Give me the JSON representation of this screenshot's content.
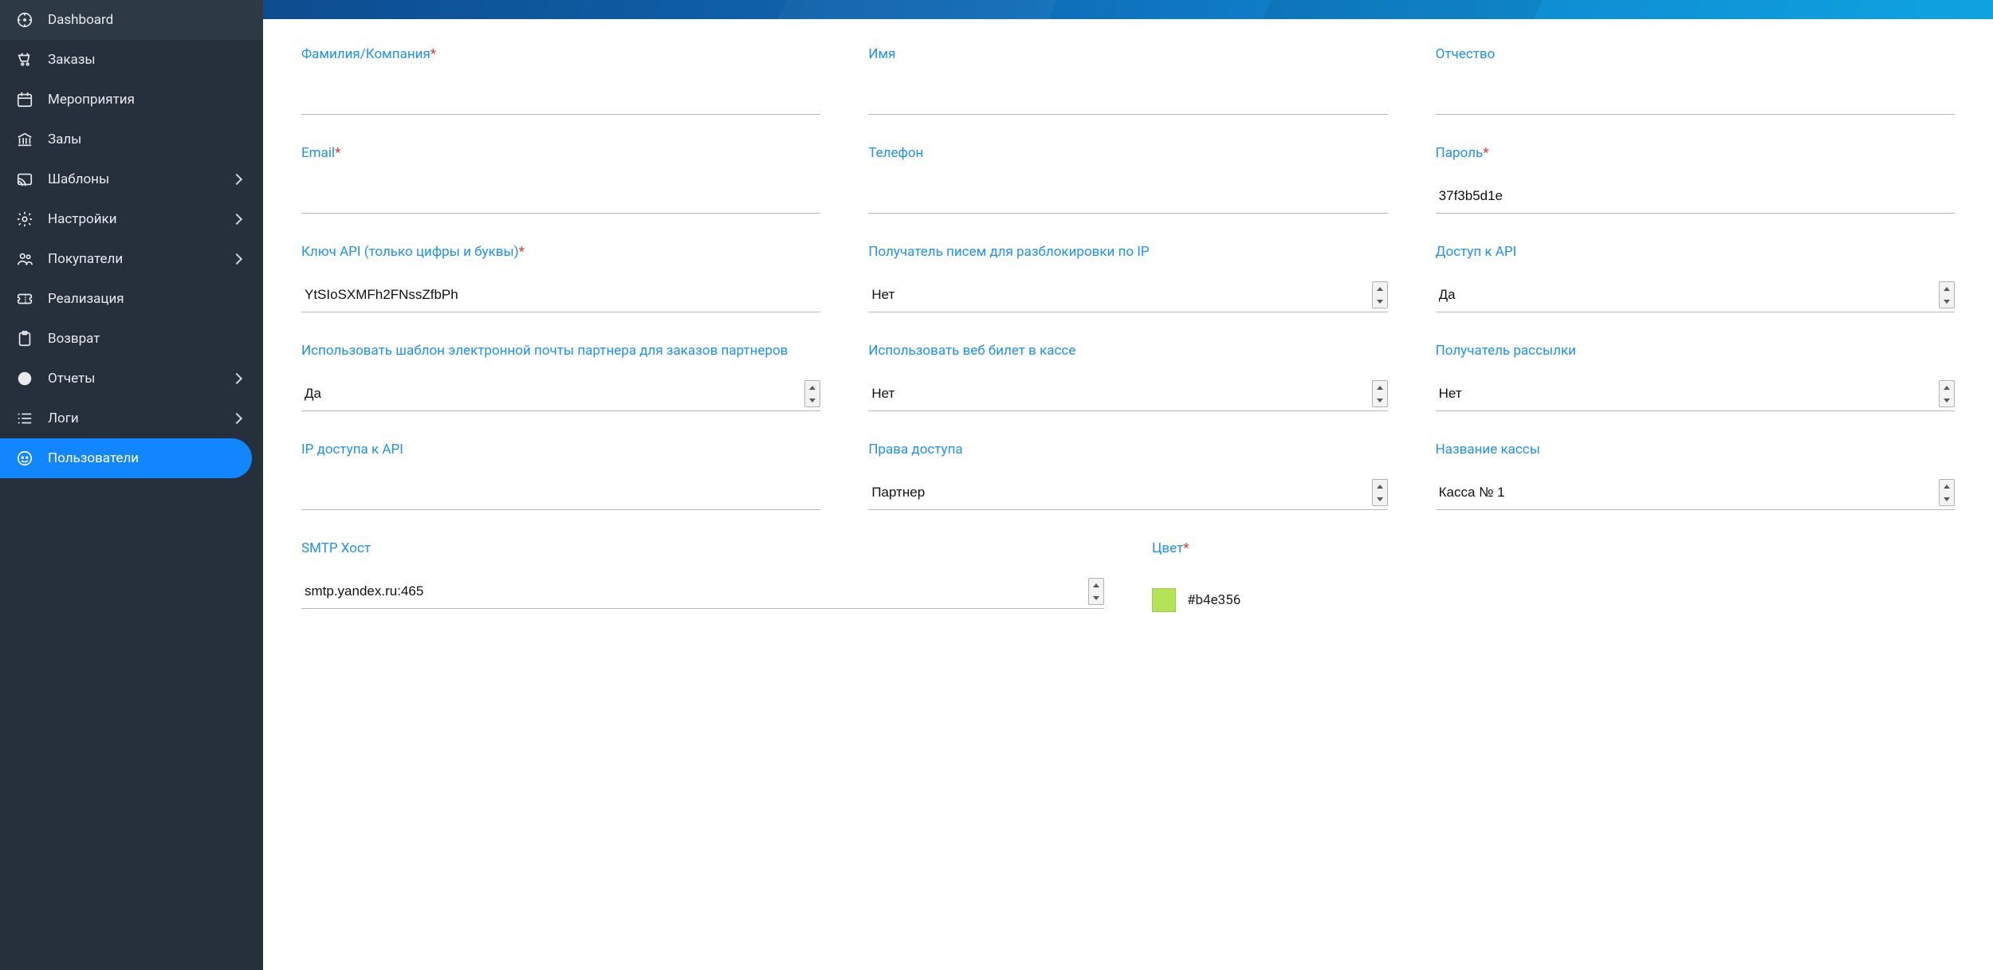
{
  "sidebar": {
    "items": [
      {
        "id": "dashboard",
        "label": "Dashboard",
        "icon": "compass-icon",
        "expandable": false
      },
      {
        "id": "orders",
        "label": "Заказы",
        "icon": "cart-icon",
        "expandable": false
      },
      {
        "id": "events",
        "label": "Мероприятия",
        "icon": "calendar-icon",
        "expandable": false
      },
      {
        "id": "halls",
        "label": "Залы",
        "icon": "bank-icon",
        "expandable": false
      },
      {
        "id": "templates",
        "label": "Шаблоны",
        "icon": "cast-icon",
        "expandable": true
      },
      {
        "id": "settings",
        "label": "Настройки",
        "icon": "gear-icon",
        "expandable": true
      },
      {
        "id": "buyers",
        "label": "Покупатели",
        "icon": "people-icon",
        "expandable": true
      },
      {
        "id": "realize",
        "label": "Реализация",
        "icon": "ticket-icon",
        "expandable": false
      },
      {
        "id": "refund",
        "label": "Возврат",
        "icon": "clipboard-icon",
        "expandable": false
      },
      {
        "id": "reports",
        "label": "Отчеты",
        "icon": "alert-icon",
        "expandable": true
      },
      {
        "id": "logs",
        "label": "Логи",
        "icon": "list-icon",
        "expandable": true
      },
      {
        "id": "users",
        "label": "Пользователи",
        "icon": "face-icon",
        "expandable": false,
        "active": true
      }
    ]
  },
  "form": {
    "labels": {
      "surname": "Фамилия/Компания",
      "name": "Имя",
      "patronym": "Отчество",
      "email": "Email",
      "phone": "Телефон",
      "password": "Пароль",
      "api_key": "Ключ API (только цифры и буквы)",
      "ip_unlock": "Получатель писем для разблокировки по IP",
      "api_access": "Доступ к API",
      "partner_tpl": "Использовать шаблон электронной почты партнера для заказов партнеров",
      "web_ticket": "Использовать веб билет в кассе",
      "mailing": "Получатель рассылки",
      "ip_api": "IP доступа к API",
      "rights": "Права доступа",
      "desk_name": "Название кассы",
      "smtp": "SMTP Хост",
      "color": "Цвет"
    },
    "required": {
      "surname": true,
      "email": true,
      "password": true,
      "api_key": true,
      "color": true
    },
    "values": {
      "surname": "",
      "name": "",
      "patronym": "",
      "email": "",
      "phone": "",
      "password": "37f3b5d1e",
      "api_key": "YtSIoSXMFh2FNssZfbPh",
      "ip_unlock": "Нет",
      "api_access": "Да",
      "partner_tpl": "Да",
      "web_ticket": "Нет",
      "mailing": "Нет",
      "ip_api": "",
      "rights": "Партнер",
      "desk_name": "Касса № 1",
      "smtp": "smtp.yandex.ru:465",
      "color_hex": "#b4e356"
    },
    "options": {
      "yes_no": [
        "Да",
        "Нет"
      ],
      "rights": [
        "Партнер"
      ],
      "desk_name": [
        "Касса № 1"
      ],
      "smtp": [
        "smtp.yandex.ru:465"
      ]
    }
  }
}
